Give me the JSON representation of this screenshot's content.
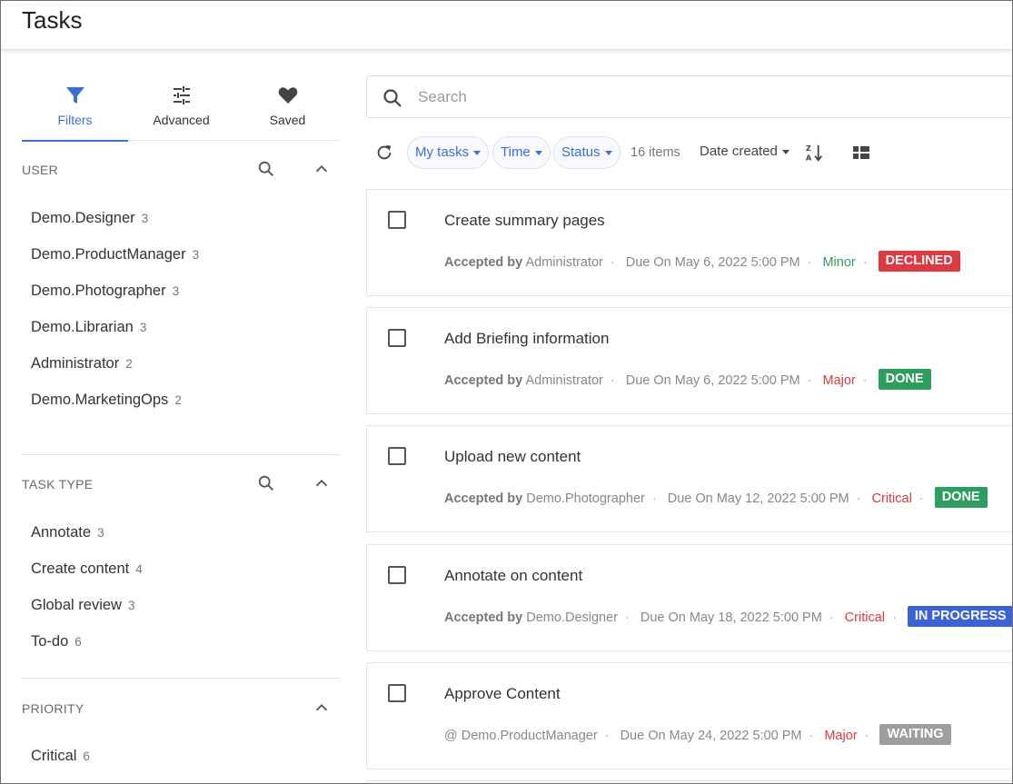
{
  "header": {
    "title": "Tasks"
  },
  "sidebar": {
    "tabs": [
      {
        "label": "Filters",
        "icon": "funnel-icon",
        "active": true
      },
      {
        "label": "Advanced",
        "icon": "sliders-icon",
        "active": false
      },
      {
        "label": "Saved",
        "icon": "heart-icon",
        "active": false
      }
    ],
    "sections": [
      {
        "title": "USER",
        "items": [
          {
            "label": "Demo.Designer",
            "count": "3"
          },
          {
            "label": "Demo.ProductManager",
            "count": "3"
          },
          {
            "label": "Demo.Photographer",
            "count": "3"
          },
          {
            "label": "Demo.Librarian",
            "count": "3"
          },
          {
            "label": "Administrator",
            "count": "2"
          },
          {
            "label": "Demo.MarketingOps",
            "count": "2"
          }
        ]
      },
      {
        "title": "TASK TYPE",
        "items": [
          {
            "label": "Annotate",
            "count": "3"
          },
          {
            "label": "Create content",
            "count": "4"
          },
          {
            "label": "Global review",
            "count": "3"
          },
          {
            "label": "To-do",
            "count": "6"
          }
        ]
      },
      {
        "title": "PRIORITY",
        "items": [
          {
            "label": "Critical",
            "count": "6"
          }
        ]
      }
    ]
  },
  "search": {
    "placeholder": "Search",
    "value": ""
  },
  "toolbar": {
    "chips": [
      "My tasks",
      "Time",
      "Status"
    ],
    "items_count": "16 items",
    "sort_by": "Date created"
  },
  "colors": {
    "accent": "#3b6fd8",
    "declined": "#e0383e",
    "done": "#2e9e5e",
    "in_progress": "#3b62d8",
    "waiting": "#9e9e9e"
  },
  "tasks": [
    {
      "title": "Create summary pages",
      "meta_label": "Accepted by",
      "assignee": "Administrator",
      "due": "Due On May 6, 2022 5:00 PM",
      "priority": "Minor",
      "status": "DECLINED"
    },
    {
      "title": "Add Briefing information",
      "meta_label": "Accepted by",
      "assignee": "Administrator",
      "due": "Due On May 6, 2022 5:00 PM",
      "priority": "Major",
      "status": "DONE"
    },
    {
      "title": "Upload new content",
      "meta_label": "Accepted by",
      "assignee": "Demo.Photographer",
      "due": "Due On May 12, 2022 5:00 PM",
      "priority": "Critical",
      "status": "DONE"
    },
    {
      "title": "Annotate on content",
      "meta_label": "Accepted by",
      "assignee": "Demo.Designer",
      "due": "Due On May 18, 2022 5:00 PM",
      "priority": "Critical",
      "status": "IN PROGRESS"
    },
    {
      "title": "Approve Content",
      "meta_label": "@",
      "assignee": "Demo.ProductManager",
      "due": "Due On May 24, 2022 5:00 PM",
      "priority": "Major",
      "status": "WAITING"
    }
  ]
}
